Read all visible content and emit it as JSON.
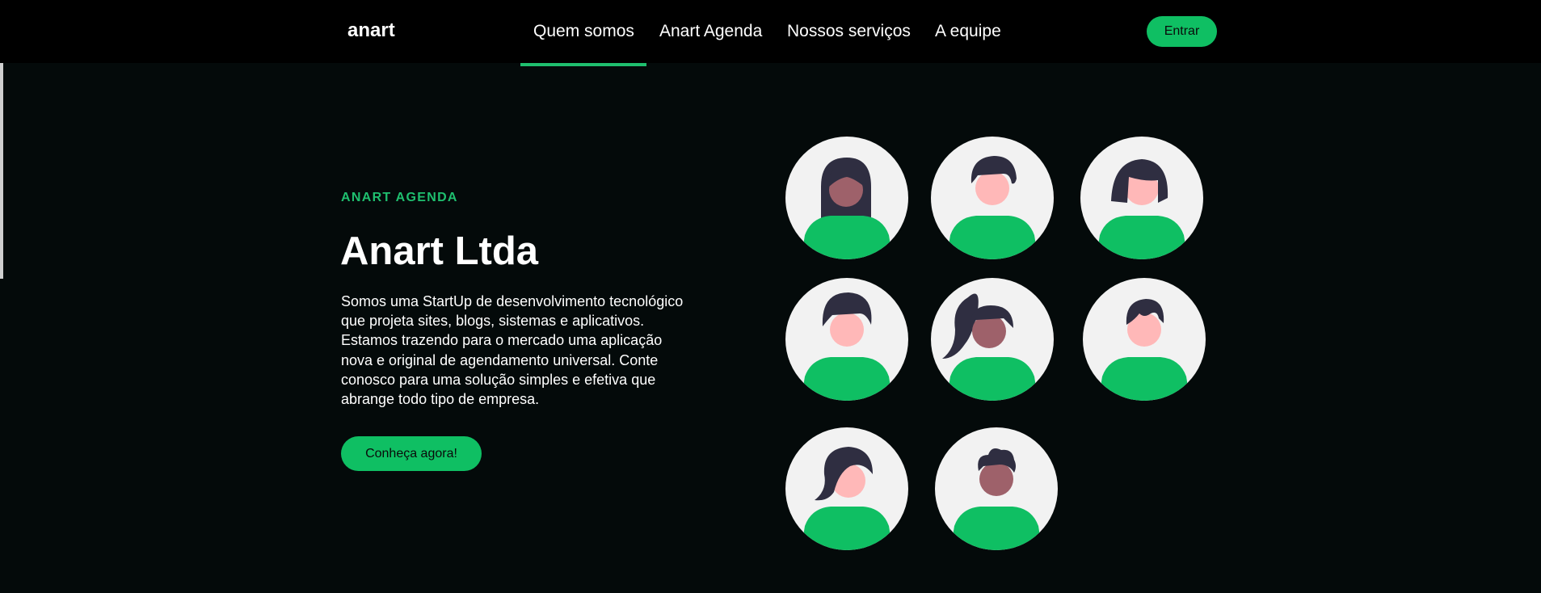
{
  "nav": {
    "brand": "anart",
    "links": [
      "Quem somos",
      "Anart Agenda",
      "Nossos serviços",
      "A equipe"
    ],
    "active_index": 0,
    "login_label": "Entrar"
  },
  "hero": {
    "eyebrow": "ANART AGENDA",
    "title": "Anart Ltda",
    "description_lines": [
      "Somos uma StartUp de desenvolvimento tecnológico",
      "que projeta sites, blogs, sistemas e aplicativos.",
      "Estamos trazendo para o mercado uma aplicação",
      "nova e original de agendamento universal. Conte",
      "conosco para uma solução simples e efetiva que",
      "abrange todo tipo de empresa."
    ],
    "cta_label": "Conheça agora!"
  },
  "team_avatars": [
    {
      "name": "avatar-1",
      "skin": "#9e616a",
      "hair": "long"
    },
    {
      "name": "avatar-2",
      "skin": "#ffb8b8",
      "hair": "short"
    },
    {
      "name": "avatar-3",
      "skin": "#ffb8b8",
      "hair": "bob"
    },
    {
      "name": "avatar-4",
      "skin": "#ffb8b8",
      "hair": "short-full"
    },
    {
      "name": "avatar-5",
      "skin": "#9e616a",
      "hair": "ponytail"
    },
    {
      "name": "avatar-6",
      "skin": "#ffb8b8",
      "hair": "tuft"
    },
    {
      "name": "avatar-7",
      "skin": "#ffb8b8",
      "hair": "wavy"
    },
    {
      "name": "avatar-8",
      "skin": "#9e616a",
      "hair": "curly-top"
    }
  ],
  "colors": {
    "accent": "#0fbf63",
    "background": "#040a0a",
    "navbar": "#000000",
    "hair": "#2f2e41",
    "avatar_bg": "#f2f2f2"
  }
}
